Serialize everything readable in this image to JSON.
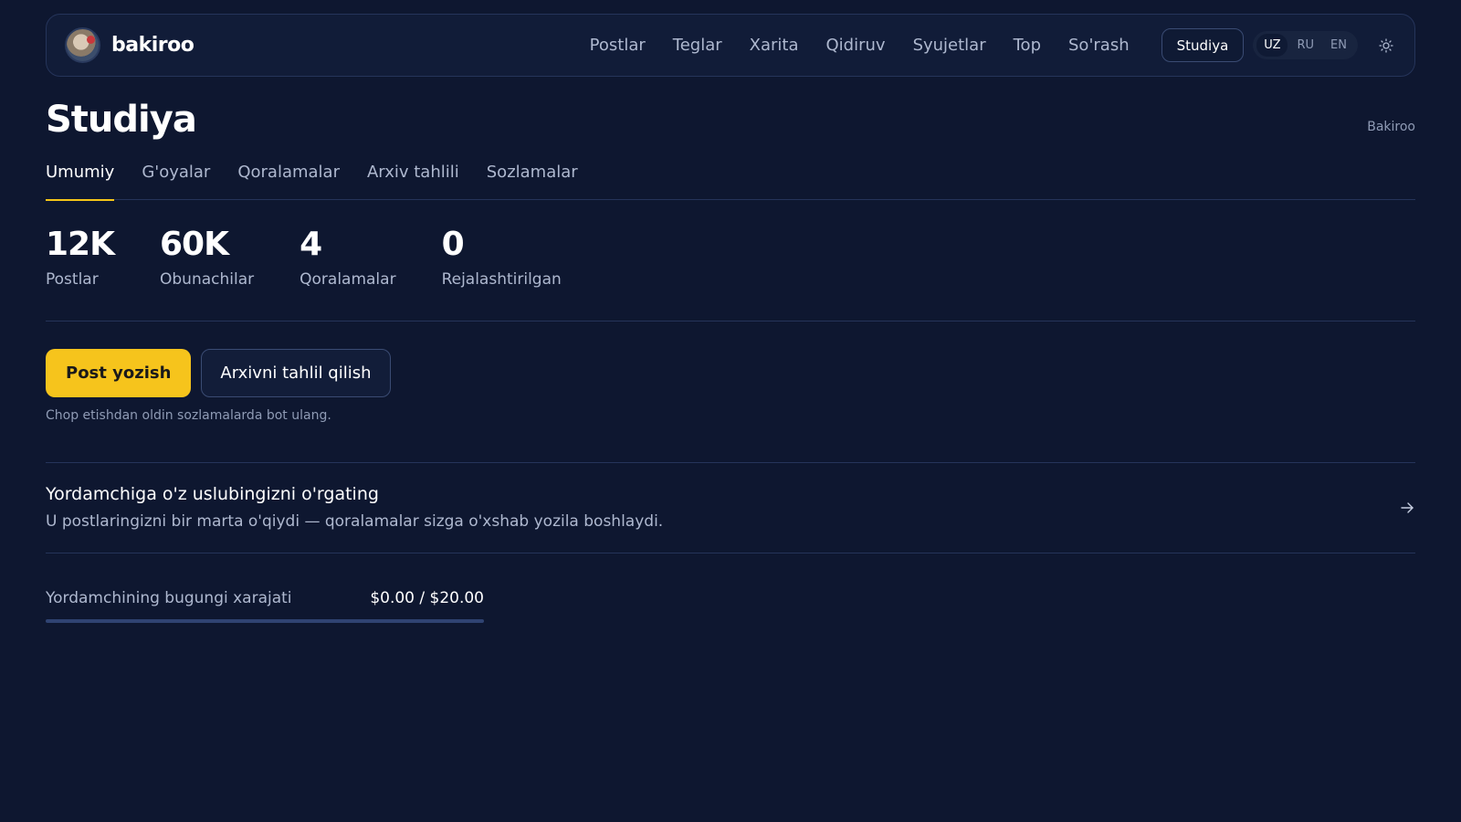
{
  "header": {
    "brand": "bakiroo",
    "nav": [
      "Postlar",
      "Teglar",
      "Xarita",
      "Qidiruv",
      "Syujetlar",
      "Top",
      "So'rash"
    ],
    "studio_button": "Studiya",
    "languages": [
      "UZ",
      "RU",
      "EN"
    ],
    "active_language": "UZ",
    "theme_icon": "sun-icon"
  },
  "page": {
    "title": "Studiya",
    "breadcrumb": "Bakiroo"
  },
  "tabs": [
    {
      "label": "Umumiy",
      "active": true
    },
    {
      "label": "G'oyalar",
      "active": false
    },
    {
      "label": "Qoralamalar",
      "active": false
    },
    {
      "label": "Arxiv tahlili",
      "active": false
    },
    {
      "label": "Sozlamalar",
      "active": false
    }
  ],
  "stats": [
    {
      "value": "12K",
      "label": "Postlar"
    },
    {
      "value": "60K",
      "label": "Obunachilar"
    },
    {
      "value": "4",
      "label": "Qoralamalar"
    },
    {
      "value": "0",
      "label": "Rejalashtirilgan"
    }
  ],
  "actions": {
    "primary": "Post yozish",
    "secondary": "Arxivni tahlil qilish",
    "hint": "Chop etishdan oldin sozlamalarda bot ulang."
  },
  "train": {
    "title": "Yordamchiga o'z uslubingizni o'rgating",
    "description": "U postlaringizni bir marta o'qiydi — qoralamalar sizga o'xshab yozila boshlaydi.",
    "icon": "arrow-right-icon"
  },
  "cost": {
    "label": "Yordamchining bugungi xarajati",
    "value": "$0.00 / $20.00",
    "progress": 0
  },
  "colors": {
    "background": "#0e1730",
    "accent": "#f6c41c",
    "border": "#25345a"
  }
}
